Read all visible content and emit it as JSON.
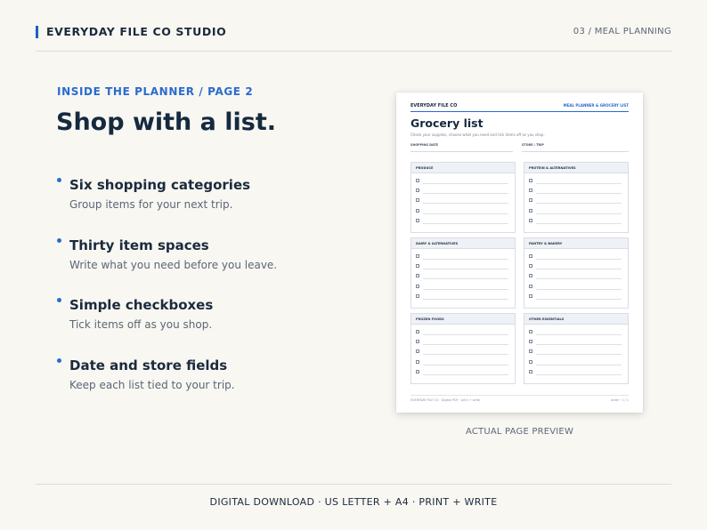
{
  "header": {
    "brand": "EVERYDAY FILE CO STUDIO",
    "section": "03 / MEAL PLANNING"
  },
  "main": {
    "kicker": "INSIDE THE PLANNER / PAGE 2",
    "headline": "Shop with a list.",
    "features": [
      {
        "title": "Six shopping categories",
        "desc": "Group items for your next trip."
      },
      {
        "title": "Thirty item spaces",
        "desc": "Write what you need before you leave."
      },
      {
        "title": "Simple checkboxes",
        "desc": "Tick items off as you shop."
      },
      {
        "title": "Date and store fields",
        "desc": "Keep each list tied to your trip."
      }
    ]
  },
  "preview": {
    "brand": "EVERYDAY FILE CO",
    "section": "MEAL PLANNER & GROCERY LIST",
    "title": "Grocery list",
    "subtitle": "Check your supplies, choose what you need and tick items off as you shop.",
    "fields": [
      "SHOPPING DATE",
      "STORE / TRIP"
    ],
    "categories": [
      "PRODUCE",
      "PROTEIN & ALTERNATIVES",
      "DAIRY & ALTERNATIVES",
      "PANTRY & BAKERY",
      "FROZEN FOODS",
      "OTHER ESSENTIALS"
    ],
    "footer_left": "EVERYDAY FILE CO · Digital PDF · print + write",
    "footer_right": "order · 1 / 1",
    "caption": "ACTUAL PAGE PREVIEW"
  },
  "footer": {
    "text": "DIGITAL DOWNLOAD · US LETTER + A4 · PRINT + WRITE"
  },
  "colors": {
    "background": "#f8f7f2",
    "accent": "#2a6bcf",
    "ink": "#15293f"
  }
}
